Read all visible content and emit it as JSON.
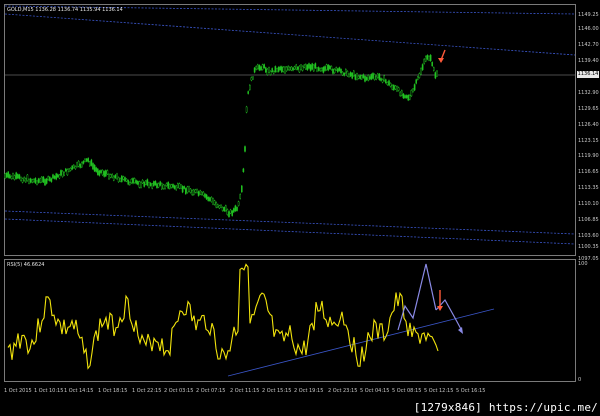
{
  "symbol_info": "GOLD,M15  1136.28 1136.74 1135.94 1136.14",
  "rsi_info": "RSI(5) 46.6624",
  "price_axis": [
    "1149.25",
    "1146.00",
    "1142.70",
    "1139.40",
    "1136.14",
    "1132.90",
    "1129.65",
    "1126.40",
    "1123.15",
    "1119.90",
    "1116.65",
    "1113.35",
    "1110.10",
    "1106.85",
    "1103.60",
    "1100.35",
    "1097.05"
  ],
  "current_price": "1136.14",
  "rsi_axis": [
    "100",
    "0"
  ],
  "time_axis": [
    "1 Oct 2015",
    "1 Oct 10:15",
    "1 Oct 14:15",
    "1 Oct 18:15",
    "1 Oct 22:15",
    "2 Oct 03:15",
    "2 Oct 07:15",
    "2 Oct 11:15",
    "2 Oct 15:15",
    "2 Oct 19:15",
    "2 Oct 23:15",
    "5 Oct 04:15",
    "5 Oct 08:15",
    "5 Oct 12:15",
    "5 Oct 16:15"
  ],
  "watermark": "[1279x846] https://upic.me/",
  "colors": {
    "candles": "#22c422",
    "rsi": "#f2e40c",
    "channel": "#3a55c8",
    "arrow_red": "#ff5a3a",
    "arrow_blue": "#8a8ae6"
  }
}
